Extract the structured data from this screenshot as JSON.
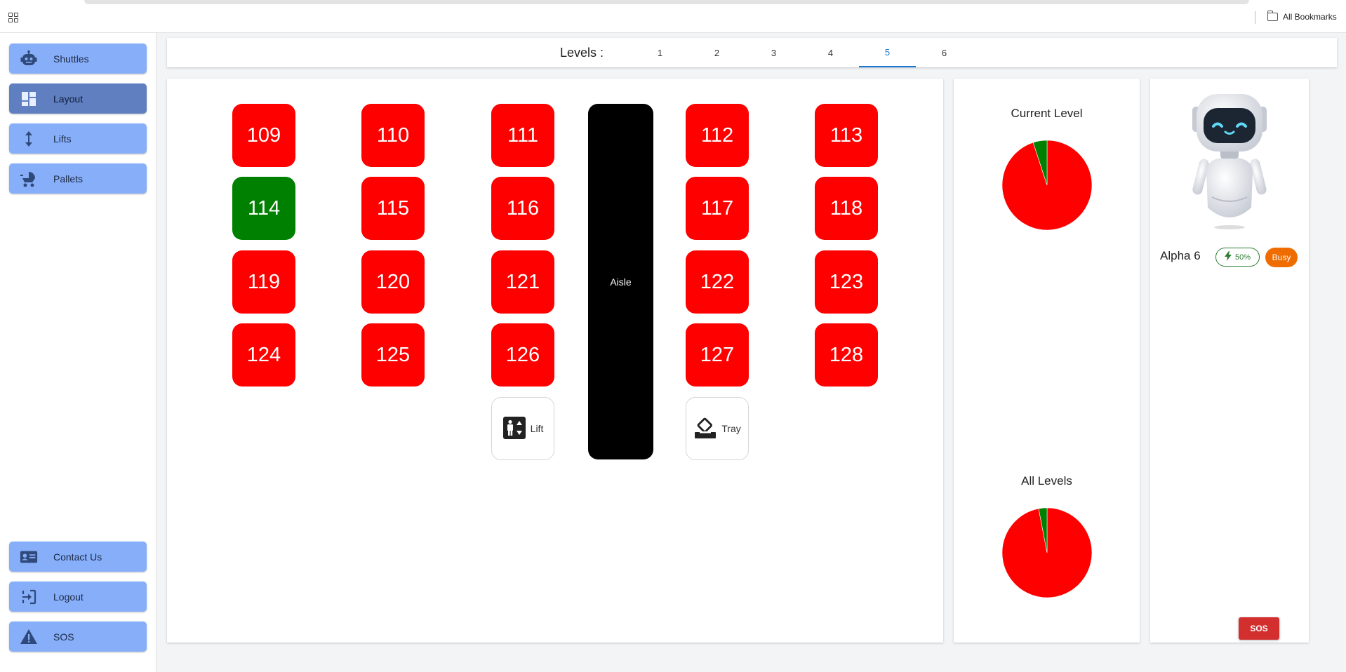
{
  "browser": {
    "bookmarks_label": "All Bookmarks"
  },
  "sidebar": {
    "top_items": [
      {
        "label": "Shuttles",
        "icon": "robot-icon",
        "active": false
      },
      {
        "label": "Layout",
        "icon": "dashboard-icon",
        "active": true
      },
      {
        "label": "Lifts",
        "icon": "vertical-arrows-icon",
        "active": false
      },
      {
        "label": "Pallets",
        "icon": "stroller-icon",
        "active": false
      }
    ],
    "bottom_items": [
      {
        "label": "Contact Us",
        "icon": "contact-card-icon"
      },
      {
        "label": "Logout",
        "icon": "logout-icon"
      },
      {
        "label": "SOS",
        "icon": "warning-icon"
      }
    ]
  },
  "levels": {
    "title": "Levels :",
    "tabs": [
      "1",
      "2",
      "3",
      "4",
      "5",
      "6"
    ],
    "selected": "5"
  },
  "layout": {
    "cells": [
      {
        "id": "109",
        "status": "red"
      },
      {
        "id": "110",
        "status": "red"
      },
      {
        "id": "111",
        "status": "red"
      },
      {
        "id": "112",
        "status": "red"
      },
      {
        "id": "113",
        "status": "red"
      },
      {
        "id": "114",
        "status": "green"
      },
      {
        "id": "115",
        "status": "red"
      },
      {
        "id": "116",
        "status": "red"
      },
      {
        "id": "117",
        "status": "red"
      },
      {
        "id": "118",
        "status": "red"
      },
      {
        "id": "119",
        "status": "red"
      },
      {
        "id": "120",
        "status": "red"
      },
      {
        "id": "121",
        "status": "red"
      },
      {
        "id": "122",
        "status": "red"
      },
      {
        "id": "123",
        "status": "red"
      },
      {
        "id": "124",
        "status": "red"
      },
      {
        "id": "125",
        "status": "red"
      },
      {
        "id": "126",
        "status": "red"
      },
      {
        "id": "127",
        "status": "red"
      },
      {
        "id": "128",
        "status": "red"
      }
    ],
    "aisle_label": "Aisle",
    "lift_label": "Lift",
    "tray_label": "Tray",
    "colors": {
      "occupied": "#ff0000",
      "free": "#008000",
      "aisle": "#000000"
    }
  },
  "charts": {
    "current_level_title": "Current Level",
    "all_levels_title": "All Levels"
  },
  "chart_data": [
    {
      "type": "pie",
      "title": "Current Level",
      "slices": [
        {
          "value": 95,
          "color": "#ff0000"
        },
        {
          "value": 5,
          "color": "#008000"
        }
      ]
    },
    {
      "type": "pie",
      "title": "All Levels",
      "slices": [
        {
          "value": 97,
          "color": "#ff0000"
        },
        {
          "value": 3,
          "color": "#008000"
        }
      ]
    }
  ],
  "robot": {
    "name": "Alpha 6",
    "battery": "50%",
    "status": "Busy",
    "sos_label": "SOS"
  }
}
